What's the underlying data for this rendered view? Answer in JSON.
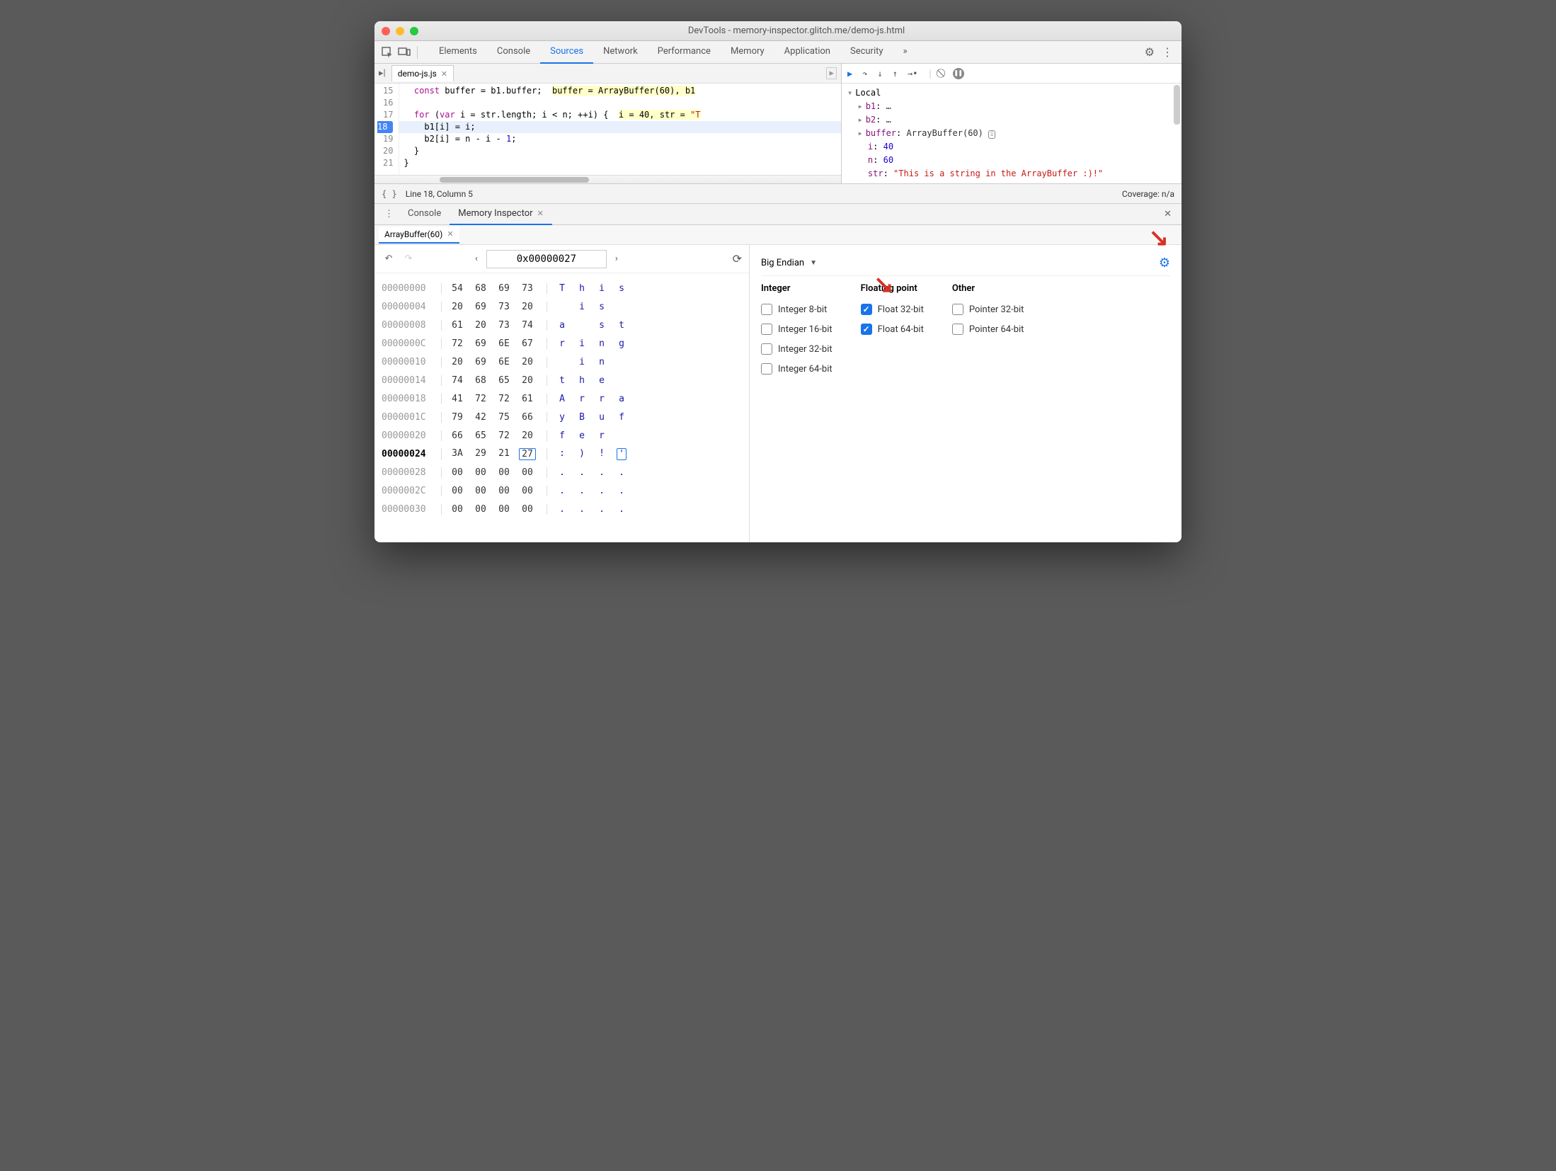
{
  "window": {
    "title": "DevTools - memory-inspector.glitch.me/demo-js.html"
  },
  "tabs": {
    "elements": "Elements",
    "console": "Console",
    "sources": "Sources",
    "network": "Network",
    "performance": "Performance",
    "memory": "Memory",
    "application": "Application",
    "security": "Security"
  },
  "file_tab": {
    "name": "demo-js.js"
  },
  "code": {
    "lines": [
      {
        "num": "15",
        "text": "  const buffer = b1.buffer;  buffer = ArrayBuffer(60), b1"
      },
      {
        "num": "16",
        "text": ""
      },
      {
        "num": "17",
        "text": "  for (var i = str.length; i < n; ++i) {  i = 40, str = \"T"
      },
      {
        "num": "18",
        "text": "    b1[i] = i;"
      },
      {
        "num": "19",
        "text": "    b2[i] = n - i - 1;"
      },
      {
        "num": "20",
        "text": "  }"
      },
      {
        "num": "21",
        "text": "}"
      }
    ]
  },
  "status": {
    "cursor": "Line 18, Column 5",
    "coverage": "Coverage: n/a"
  },
  "scope": {
    "header": "Local",
    "b1": {
      "name": "b1",
      "val": "…"
    },
    "b2": {
      "name": "b2",
      "val": "…"
    },
    "buffer": {
      "name": "buffer",
      "val": "ArrayBuffer(60)"
    },
    "i": {
      "name": "i",
      "val": "40"
    },
    "n": {
      "name": "n",
      "val": "60"
    },
    "str": {
      "name": "str",
      "val": "\"This is a string in the ArrayBuffer :)!\""
    }
  },
  "drawer": {
    "console": "Console",
    "memory_inspector": "Memory Inspector"
  },
  "mi": {
    "tab": "ArrayBuffer(60)",
    "address": "0x00000027",
    "endian": "Big Endian",
    "headers": {
      "integer": "Integer",
      "float": "Floating point",
      "other": "Other"
    },
    "types": {
      "int8": "Integer 8-bit",
      "int16": "Integer 16-bit",
      "int32": "Integer 32-bit",
      "int64": "Integer 64-bit",
      "f32": "Float 32-bit",
      "f64": "Float 64-bit",
      "p32": "Pointer 32-bit",
      "p64": "Pointer 64-bit"
    },
    "rows": [
      {
        "addr": "00000000",
        "b": [
          "54",
          "68",
          "69",
          "73"
        ],
        "a": [
          "T",
          "h",
          "i",
          "s"
        ]
      },
      {
        "addr": "00000004",
        "b": [
          "20",
          "69",
          "73",
          "20"
        ],
        "a": [
          " ",
          "i",
          "s",
          " "
        ]
      },
      {
        "addr": "00000008",
        "b": [
          "61",
          "20",
          "73",
          "74"
        ],
        "a": [
          "a",
          " ",
          "s",
          "t"
        ]
      },
      {
        "addr": "0000000C",
        "b": [
          "72",
          "69",
          "6E",
          "67"
        ],
        "a": [
          "r",
          "i",
          "n",
          "g"
        ]
      },
      {
        "addr": "00000010",
        "b": [
          "20",
          "69",
          "6E",
          "20"
        ],
        "a": [
          " ",
          "i",
          "n",
          " "
        ]
      },
      {
        "addr": "00000014",
        "b": [
          "74",
          "68",
          "65",
          "20"
        ],
        "a": [
          "t",
          "h",
          "e",
          " "
        ]
      },
      {
        "addr": "00000018",
        "b": [
          "41",
          "72",
          "72",
          "61"
        ],
        "a": [
          "A",
          "r",
          "r",
          "a"
        ]
      },
      {
        "addr": "0000001C",
        "b": [
          "79",
          "42",
          "75",
          "66"
        ],
        "a": [
          "y",
          "B",
          "u",
          "f"
        ]
      },
      {
        "addr": "00000020",
        "b": [
          "66",
          "65",
          "72",
          "20"
        ],
        "a": [
          "f",
          "e",
          "r",
          " "
        ]
      },
      {
        "addr": "00000024",
        "b": [
          "3A",
          "29",
          "21",
          "27"
        ],
        "a": [
          ":",
          ")",
          "!",
          "'"
        ],
        "cur": true,
        "sel": 3
      },
      {
        "addr": "00000028",
        "b": [
          "00",
          "00",
          "00",
          "00"
        ],
        "a": [
          ".",
          ".",
          ".",
          "."
        ]
      },
      {
        "addr": "0000002C",
        "b": [
          "00",
          "00",
          "00",
          "00"
        ],
        "a": [
          ".",
          ".",
          ".",
          "."
        ]
      },
      {
        "addr": "00000030",
        "b": [
          "00",
          "00",
          "00",
          "00"
        ],
        "a": [
          ".",
          ".",
          ".",
          "."
        ]
      }
    ]
  }
}
